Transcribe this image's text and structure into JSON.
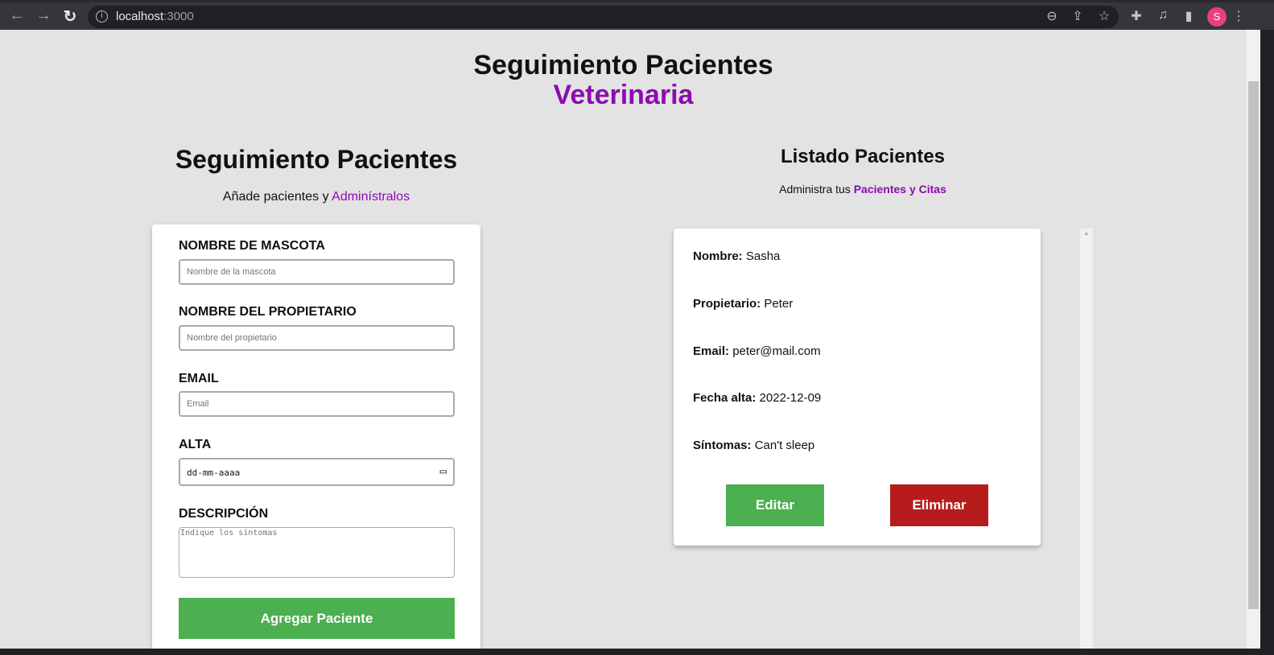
{
  "browser": {
    "url_host": "localhost",
    "url_port": ":3000",
    "profile_initial": "S",
    "icons": [
      "back-icon",
      "forward-icon",
      "reload-icon",
      "info-icon",
      "zoom-icon",
      "share-icon",
      "star-icon",
      "extensions-icon",
      "media-icon",
      "side-panel-icon",
      "menu-icon"
    ]
  },
  "header": {
    "title": "Seguimiento Pacientes",
    "subtitle": "Veterinaria"
  },
  "form": {
    "title": "Seguimiento Pacientes",
    "intro": "Añade pacientes y ",
    "intro_link": "Adminístralos",
    "pet_label": "NOMBRE DE MASCOTA",
    "pet_placeholder": "Nombre de la mascota",
    "owner_label": "NOMBRE DEL PROPIETARIO",
    "owner_placeholder": "Nombre del propietario",
    "email_label": "EMAIL",
    "email_placeholder": "Email",
    "date_label": "ALTA",
    "date_placeholder": "dd-mm-aaaa",
    "desc_label": "DESCRIPCIÓN",
    "desc_placeholder": "Indique los síntomas",
    "submit": "Agregar Paciente"
  },
  "list": {
    "title": "Listado Pacientes",
    "intro": "Administra tus ",
    "intro_link": "Pacientes y Citas",
    "patients": [
      {
        "name_label": "Nombre:",
        "name": "Sasha",
        "owner_label": "Propietario:",
        "owner": "Peter",
        "email_label": "Email:",
        "email": "peter@mail.com",
        "date_label": "Fecha alta:",
        "date": "2022-12-09",
        "symptoms_label": "Síntomas:",
        "symptoms": "Can't sleep",
        "edit": "Editar",
        "delete": "Eliminar"
      }
    ]
  },
  "colors": {
    "accent": "#8e0bb0",
    "green": "#4caf50",
    "red": "#b71c1c",
    "background": "#e3e3e3"
  }
}
